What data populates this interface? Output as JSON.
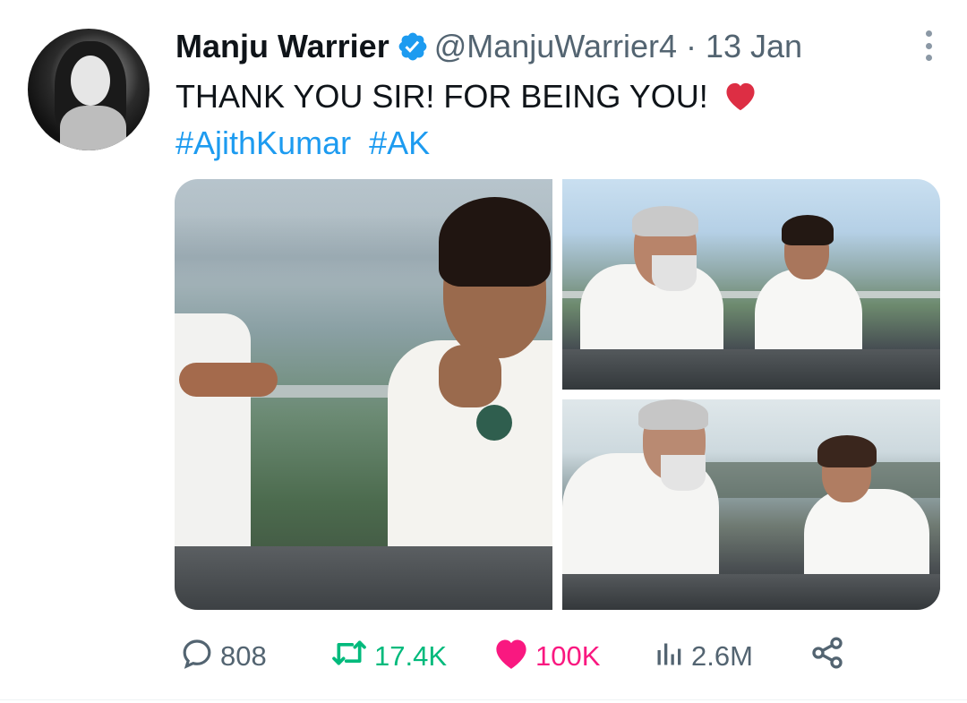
{
  "tweet": {
    "author_name": "Manju Warrier",
    "handle": "@ManjuWarrier4",
    "separator": "·",
    "date": "13 Jan",
    "text": "THANK YOU SIR! FOR BEING YOU!",
    "text_emoji": "red-heart",
    "hashtags": [
      "#AjithKumar",
      "#AK"
    ]
  },
  "icons": {
    "verified": "verified-badge-icon",
    "more": "more-options-icon",
    "reply": "reply-icon",
    "retweet": "retweet-icon",
    "like": "like-heart-icon",
    "views": "views-chart-icon",
    "share": "share-icon"
  },
  "stats": {
    "replies": "808",
    "retweets": "17.4K",
    "likes": "100K",
    "views": "2.6M"
  },
  "colors": {
    "link": "#1d9bf0",
    "muted": "#536471",
    "retweet": "#00ba7c",
    "like": "#f91880",
    "verified": "#1d9bf0"
  }
}
